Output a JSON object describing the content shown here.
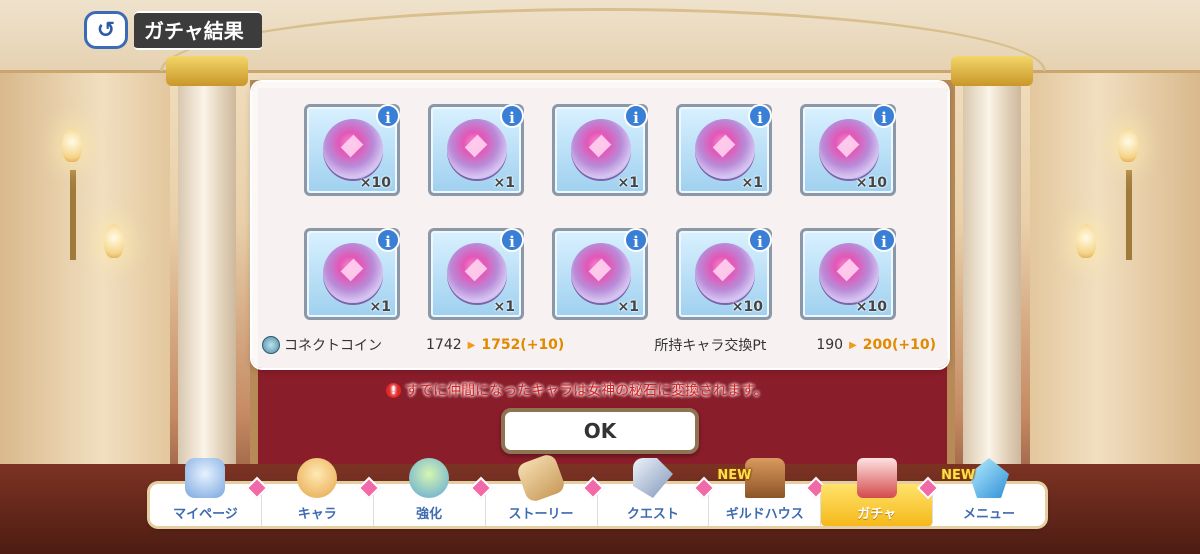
{
  "header": {
    "title": "ガチャ結果",
    "back_icon": "back-arrow-icon"
  },
  "items": [
    {
      "qty": "×10"
    },
    {
      "qty": "×1"
    },
    {
      "qty": "×1"
    },
    {
      "qty": "×1"
    },
    {
      "qty": "×10"
    },
    {
      "qty": "×1"
    },
    {
      "qty": "×1"
    },
    {
      "qty": "×1"
    },
    {
      "qty": "×10"
    },
    {
      "qty": "×10"
    }
  ],
  "info_label": "i",
  "stats": {
    "coin_label": "コネクトコイン",
    "coin_old": "1742",
    "coin_new": "1752(+10)",
    "pt_label": "所持キャラ交換Pt",
    "pt_old": "190",
    "pt_new": "200(+10)"
  },
  "notice": {
    "icon": "!",
    "text": "すでに仲間になったキャラは女神の秘石に変換されます。"
  },
  "ok_label": "OK",
  "nav": {
    "items": [
      {
        "label": "マイページ",
        "badge": true
      },
      {
        "label": "キャラ",
        "badge": true
      },
      {
        "label": "強化",
        "badge": true
      },
      {
        "label": "ストーリー",
        "badge": true
      },
      {
        "label": "クエスト",
        "badge": true
      },
      {
        "label": "ギルドハウス",
        "badge": true,
        "new": "NEW"
      },
      {
        "label": "ガチャ",
        "badge": true,
        "active": true
      },
      {
        "label": "メニュー",
        "badge": false,
        "new": "NEW"
      }
    ]
  },
  "colors": {
    "accent": "#f5b91a",
    "nav_text": "#3f6bb0",
    "notice": "#d42020",
    "increase": "#e08a00"
  }
}
